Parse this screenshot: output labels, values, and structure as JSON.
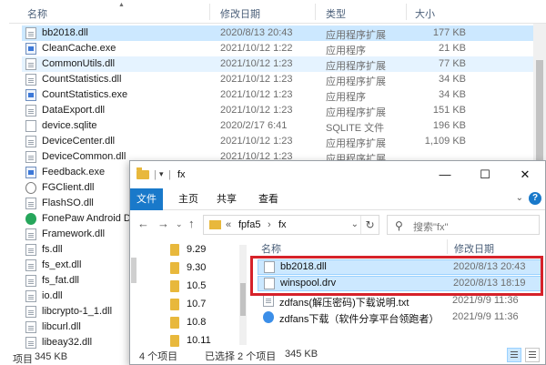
{
  "background": {
    "columns": {
      "name": "名称",
      "date": "修改日期",
      "type": "类型",
      "size": "大小"
    },
    "rows": [
      {
        "name": "bb2018.dll",
        "date": "2020/8/13 20:43",
        "type": "应用程序扩展",
        "size": "177 KB",
        "icon": "dll-icon",
        "state": "selected"
      },
      {
        "name": "CleanCache.exe",
        "date": "2021/10/12 1:22",
        "type": "应用程序",
        "size": "21 KB",
        "icon": "exe-icon",
        "state": ""
      },
      {
        "name": "CommonUtils.dll",
        "date": "2021/10/12 1:23",
        "type": "应用程序扩展",
        "size": "77 KB",
        "icon": "dll-icon",
        "state": "hover"
      },
      {
        "name": "CountStatistics.dll",
        "date": "2021/10/12 1:23",
        "type": "应用程序扩展",
        "size": "34 KB",
        "icon": "dll-icon",
        "state": ""
      },
      {
        "name": "CountStatistics.exe",
        "date": "2021/10/12 1:23",
        "type": "应用程序",
        "size": "34 KB",
        "icon": "exe-icon",
        "state": ""
      },
      {
        "name": "DataExport.dll",
        "date": "2021/10/12 1:23",
        "type": "应用程序扩展",
        "size": "151 KB",
        "icon": "dll-icon",
        "state": ""
      },
      {
        "name": "device.sqlite",
        "date": "2020/2/17 6:41",
        "type": "SQLITE 文件",
        "size": "196 KB",
        "icon": "file-icon",
        "state": ""
      },
      {
        "name": "DeviceCenter.dll",
        "date": "2021/10/12 1:23",
        "type": "应用程序扩展",
        "size": "1,109 KB",
        "icon": "dll-icon",
        "state": ""
      },
      {
        "name": "DeviceCommon.dll",
        "date": "2021/10/12 1:23",
        "type": "应用程序扩展",
        "size": "",
        "icon": "dll-icon",
        "state": ""
      },
      {
        "name": "Feedback.exe",
        "date": "",
        "type": "",
        "size": "",
        "icon": "exe-icon",
        "state": ""
      },
      {
        "name": "FGClient.dll",
        "date": "",
        "type": "",
        "size": "",
        "icon": "gear-icon",
        "state": ""
      },
      {
        "name": "FlashSO.dll",
        "date": "",
        "type": "",
        "size": "",
        "icon": "dll-icon",
        "state": ""
      },
      {
        "name": "FonePaw Android D",
        "date": "",
        "type": "",
        "size": "",
        "icon": "app-icon",
        "state": ""
      },
      {
        "name": "Framework.dll",
        "date": "",
        "type": "",
        "size": "",
        "icon": "dll-icon",
        "state": ""
      },
      {
        "name": "fs.dll",
        "date": "",
        "type": "",
        "size": "",
        "icon": "dll-icon",
        "state": ""
      },
      {
        "name": "fs_ext.dll",
        "date": "",
        "type": "",
        "size": "",
        "icon": "dll-icon",
        "state": ""
      },
      {
        "name": "fs_fat.dll",
        "date": "",
        "type": "",
        "size": "",
        "icon": "dll-icon",
        "state": ""
      },
      {
        "name": "io.dll",
        "date": "",
        "type": "",
        "size": "",
        "icon": "dll-icon",
        "state": ""
      },
      {
        "name": "libcrypto-1_1.dll",
        "date": "",
        "type": "",
        "size": "",
        "icon": "dll-icon",
        "state": ""
      },
      {
        "name": "libcurl.dll",
        "date": "",
        "type": "",
        "size": "",
        "icon": "dll-icon",
        "state": ""
      },
      {
        "name": "libeay32.dll",
        "date": "",
        "type": "",
        "size": "",
        "icon": "dll-icon",
        "state": ""
      }
    ],
    "status": {
      "count": "项目",
      "size": "345 KB"
    }
  },
  "window": {
    "title": "fx",
    "ribbon_tabs": [
      "文件",
      "主页",
      "共享",
      "查看"
    ],
    "address": {
      "prefix": "«",
      "crumbs": [
        "fpfa5",
        "fx"
      ]
    },
    "search_placeholder": "搜索\"fx\"",
    "nav_folders": [
      "9.29",
      "9.30",
      "10.5",
      "10.7",
      "10.8",
      "10.11"
    ],
    "columns": {
      "name": "名称",
      "date": "修改日期"
    },
    "files": [
      {
        "name": "bb2018.dll",
        "date": "2020/8/13 20:43",
        "icon": "dll-icon",
        "selected": true
      },
      {
        "name": "winspool.drv",
        "date": "2020/8/13 18:19",
        "icon": "file-icon",
        "selected": true
      },
      {
        "name": "zdfans(解压密码)下载说明.txt",
        "date": "2021/9/9 11:36",
        "icon": "text-file-icon",
        "selected": false
      },
      {
        "name": "zdfans下载（软件分享平台领跑者）",
        "date": "2021/9/9 11:36",
        "icon": "web-shortcut-icon",
        "selected": false
      }
    ],
    "status": {
      "count": "4 个项目",
      "selected": "已选择 2 个项目",
      "size": "345 KB"
    },
    "highlight_color": "#d6222a",
    "accent_color": "#1979ca"
  }
}
